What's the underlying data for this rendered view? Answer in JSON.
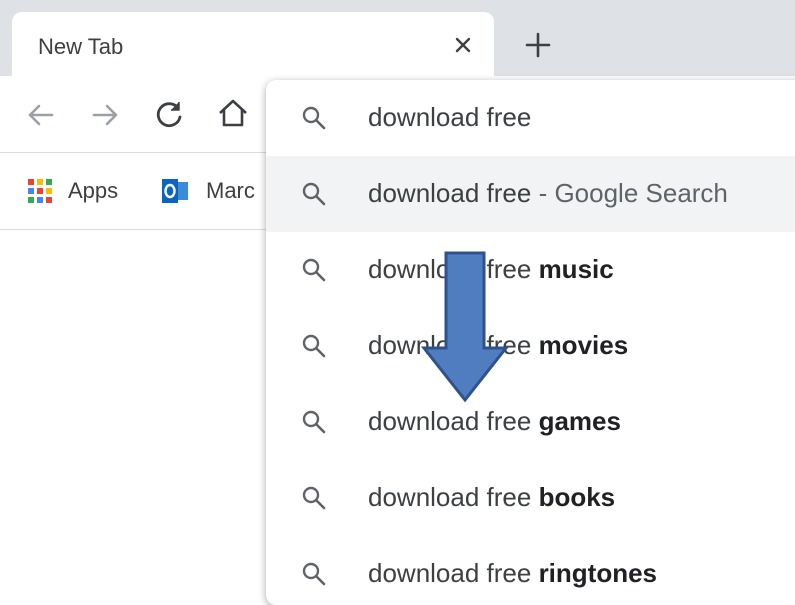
{
  "tab": {
    "title": "New Tab"
  },
  "toolbar": {
    "back_icon": "arrow-left-icon",
    "forward_icon": "arrow-right-icon",
    "reload_icon": "reload-icon",
    "home_icon": "home-icon"
  },
  "bookmarks": [
    {
      "label": "Apps",
      "icon": "apps-grid-icon"
    },
    {
      "label": "Marc",
      "icon": "outlook-icon"
    }
  ],
  "omnibox": {
    "input_value": "download free",
    "suggestions": [
      {
        "prefix": "download free",
        "bold": "",
        "suffix": " - Google Search"
      },
      {
        "prefix": "download free ",
        "bold": "music",
        "suffix": ""
      },
      {
        "prefix": "download free ",
        "bold": "movies",
        "suffix": ""
      },
      {
        "prefix": "download free ",
        "bold": "games",
        "suffix": ""
      },
      {
        "prefix": "download free ",
        "bold": "books",
        "suffix": ""
      },
      {
        "prefix": "download free ",
        "bold": "ringtones",
        "suffix": ""
      }
    ]
  },
  "colors": {
    "tabstrip_bg": "#dee1e6",
    "selected_row_bg": "#f1f3f4",
    "arrow_fill": "#4f7dbf",
    "arrow_stroke": "#2f528f"
  }
}
